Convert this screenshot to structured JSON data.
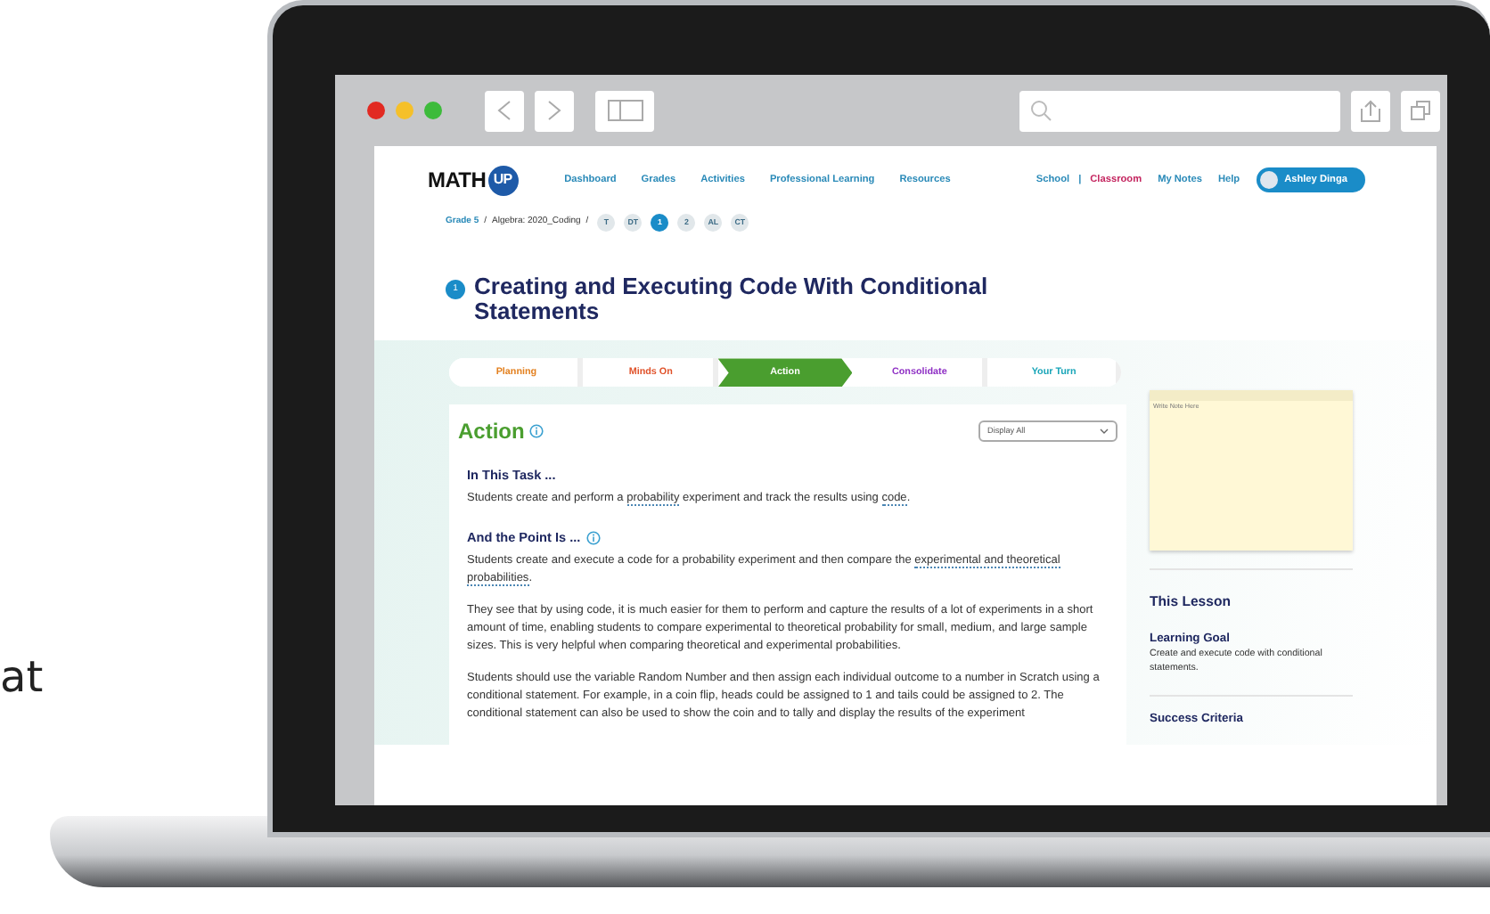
{
  "side_text": "at",
  "header": {
    "logo": {
      "text": "MATH",
      "badge": "UP"
    },
    "nav": [
      "Dashboard",
      "Grades",
      "Activities",
      "Professional Learning",
      "Resources"
    ],
    "view_toggle": [
      {
        "label": "School",
        "selected": false
      },
      {
        "label": "Classroom",
        "selected": true
      }
    ],
    "view_separator": "|",
    "links": [
      "My Notes",
      "Help"
    ],
    "user": "Ashley Dinga"
  },
  "breadcrumb": {
    "items": [
      "Grade 5",
      "Algebra: 2020_Coding"
    ],
    "separator": "/",
    "chips": [
      {
        "label": "T",
        "selected": false
      },
      {
        "label": "DT",
        "selected": false
      },
      {
        "label": "1",
        "selected": true
      },
      {
        "label": "2",
        "selected": false
      },
      {
        "label": "AL",
        "selected": false
      },
      {
        "label": "CT",
        "selected": false
      }
    ]
  },
  "lesson": {
    "number": "1",
    "title": "Creating and Executing Code With Conditional Statements"
  },
  "phases": [
    {
      "label": "Planning",
      "color": "#e3801f",
      "selected": false
    },
    {
      "label": "Minds On",
      "color": "#e0522a",
      "selected": false
    },
    {
      "label": "Action",
      "color": "#4a9e2f",
      "selected": true
    },
    {
      "label": "Consolidate",
      "color": "#8e2fc4",
      "selected": false
    },
    {
      "label": "Your Turn",
      "color": "#19a5b8",
      "selected": false
    }
  ],
  "action": {
    "heading": "Action",
    "filter": "Display All",
    "sections": [
      {
        "heading": "In This Task ...",
        "info": false,
        "paragraphs": [
          [
            {
              "text": "Students create and perform a ",
              "term": false
            },
            {
              "text": "probability",
              "term": true
            },
            {
              "text": " experiment and track the results using ",
              "term": false
            },
            {
              "text": "code",
              "term": true
            },
            {
              "text": ".",
              "term": false
            }
          ]
        ]
      },
      {
        "heading": "And the Point Is ...",
        "info": true,
        "paragraphs": [
          [
            {
              "text": "Students create and execute a code for a probability experiment and then compare the ",
              "term": false
            },
            {
              "text": "experimental and theoretical probabilities",
              "term": true
            },
            {
              "text": ".",
              "term": false
            }
          ],
          [
            {
              "text": "They see that by using code, it is much easier for them to perform and capture the results of a lot of experiments in a short amount of time, enabling students to compare experimental to theoretical probability for small, medium, and large sample sizes. This is very helpful when comparing theoretical and experimental probabilities.",
              "term": false
            }
          ],
          [
            {
              "text": "Students should use the variable Random Number and then assign each individual outcome to a number in Scratch using a conditional statement. For example, in a coin flip, heads could be assigned to 1 and tails could be assigned to 2. The conditional statement can also be used to show the coin and to tally and display the results of the experiment",
              "term": false
            }
          ]
        ]
      }
    ]
  },
  "sidebar": {
    "note": {
      "placeholder": "Write Note Here"
    },
    "heading": "This Lesson",
    "sections": [
      {
        "heading": "Learning Goal",
        "text": "Create and execute code with conditional statements."
      },
      {
        "heading": "Success Criteria"
      }
    ]
  }
}
